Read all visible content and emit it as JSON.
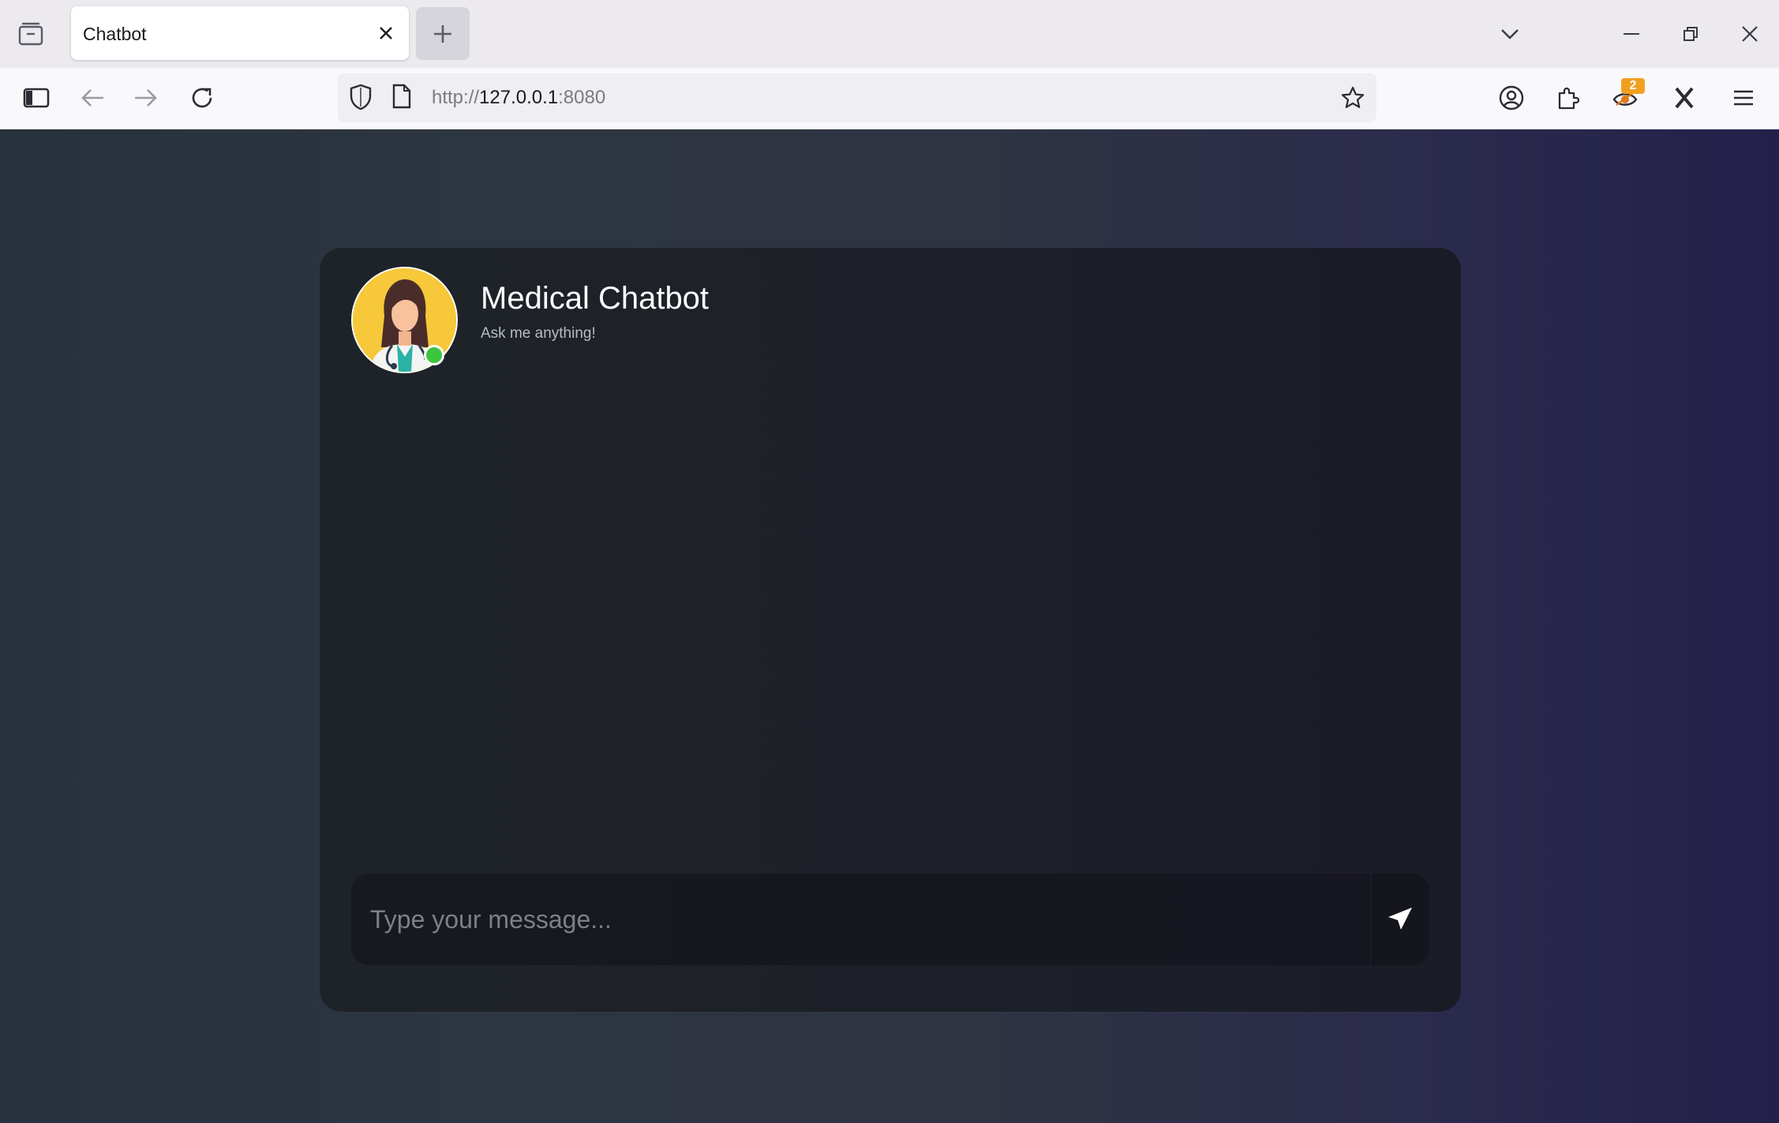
{
  "browser": {
    "tab_title": "Chatbot",
    "url_scheme": "http://",
    "url_host": "127.0.0.1",
    "url_port": ":8080",
    "extension_badge": "2"
  },
  "chat": {
    "title": "Medical Chatbot",
    "subtitle": "Ask me anything!",
    "input_placeholder": "Type your message...",
    "status": "online"
  },
  "colors": {
    "status_online": "#3cc63c",
    "avatar_bg": "#f6c83a",
    "card_bg": "#1e2229"
  }
}
